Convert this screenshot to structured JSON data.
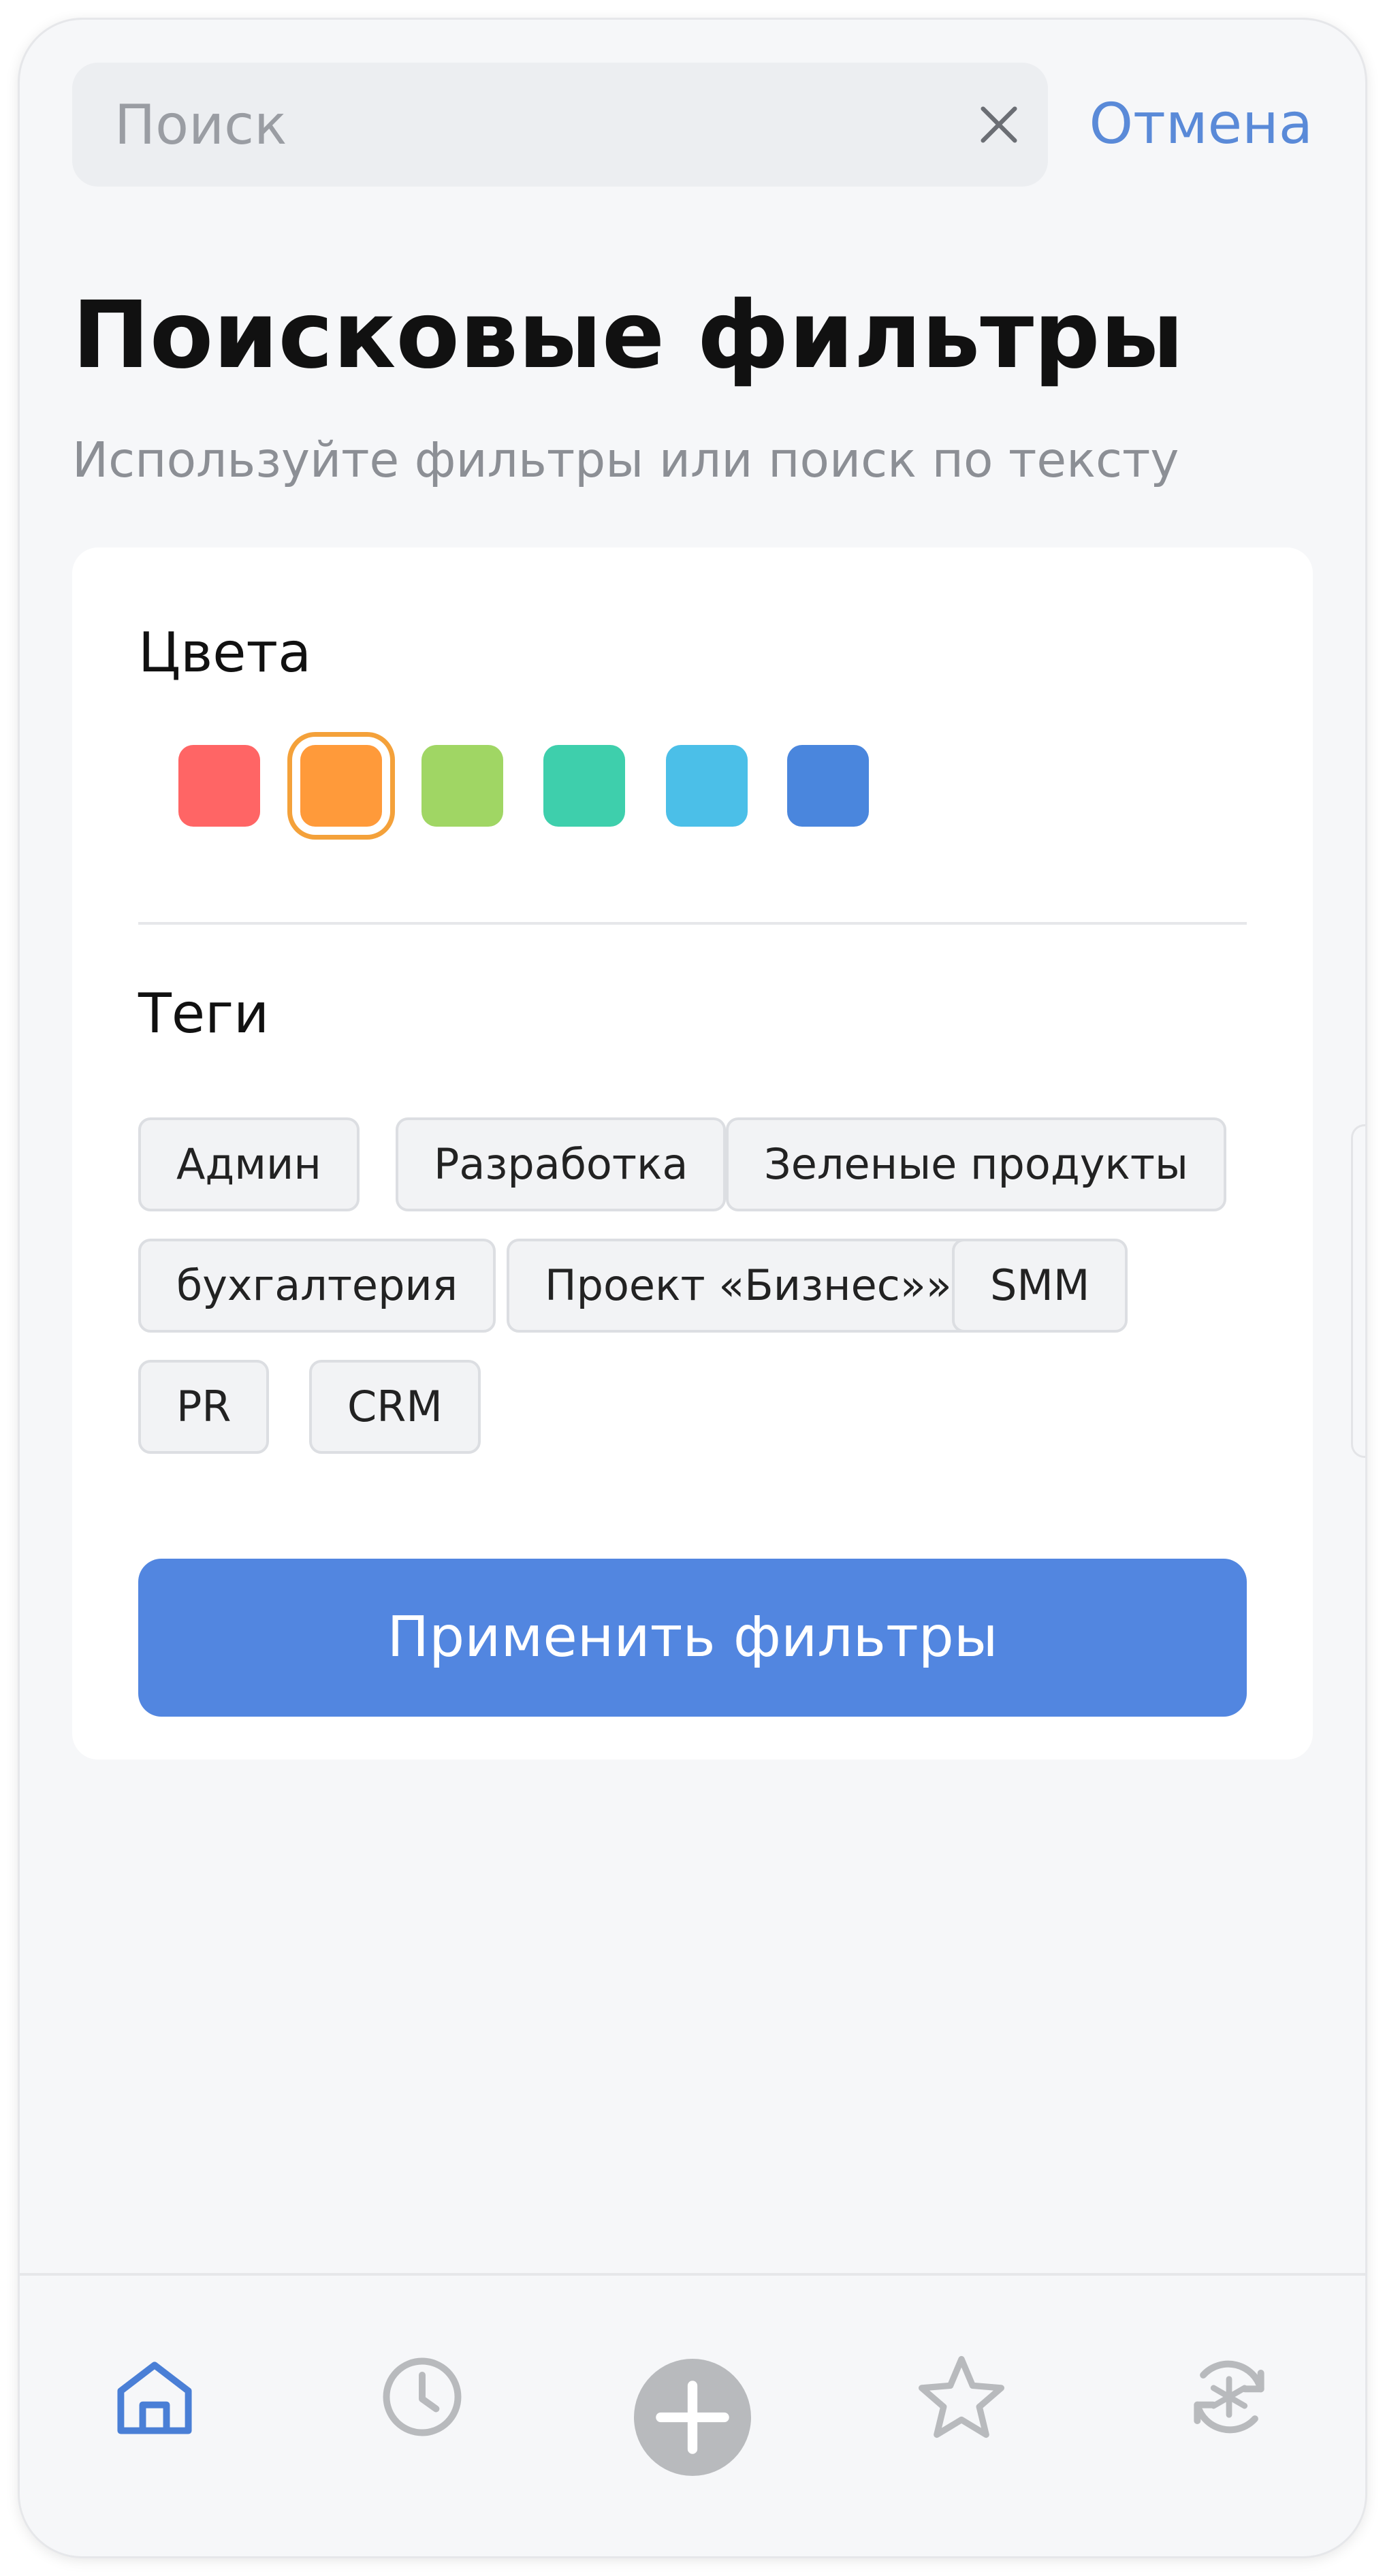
{
  "search": {
    "placeholder": "Поиск",
    "value": "",
    "cancel_label": "Отмена",
    "clear_icon": "close-icon"
  },
  "header": {
    "title": "Поисковые фильтры",
    "subtitle": "Используйте фильтры или поиск по тексту"
  },
  "filters": {
    "colors_title": "Цвета",
    "colors": [
      {
        "name": "red",
        "hex": "#ff6565",
        "selected": false
      },
      {
        "name": "orange",
        "hex": "#ff9a3a",
        "selected": true
      },
      {
        "name": "green",
        "hex": "#a0d664",
        "selected": false
      },
      {
        "name": "teal",
        "hex": "#3ecfac",
        "selected": false
      },
      {
        "name": "sky-blue",
        "hex": "#4bbfe8",
        "selected": false
      },
      {
        "name": "blue",
        "hex": "#4a86dd",
        "selected": false
      }
    ],
    "tags_title": "Теги",
    "tags": [
      "Админ",
      "Разработка",
      "Зеленые продукты",
      "бухгалтерия",
      "Проект «Бизнес»»",
      "SMM",
      "PR",
      "CRM"
    ],
    "apply_label": "Применить фильтры"
  },
  "tabbar": {
    "items": [
      {
        "icon": "home-icon",
        "active": true
      },
      {
        "icon": "clock-icon",
        "active": false
      },
      {
        "icon": "plus-icon",
        "active": false
      },
      {
        "icon": "star-icon",
        "active": false
      },
      {
        "icon": "sync-asterisk-icon",
        "active": false
      }
    ],
    "active_color": "#4a7fd6",
    "inactive_color": "#b8babd"
  }
}
